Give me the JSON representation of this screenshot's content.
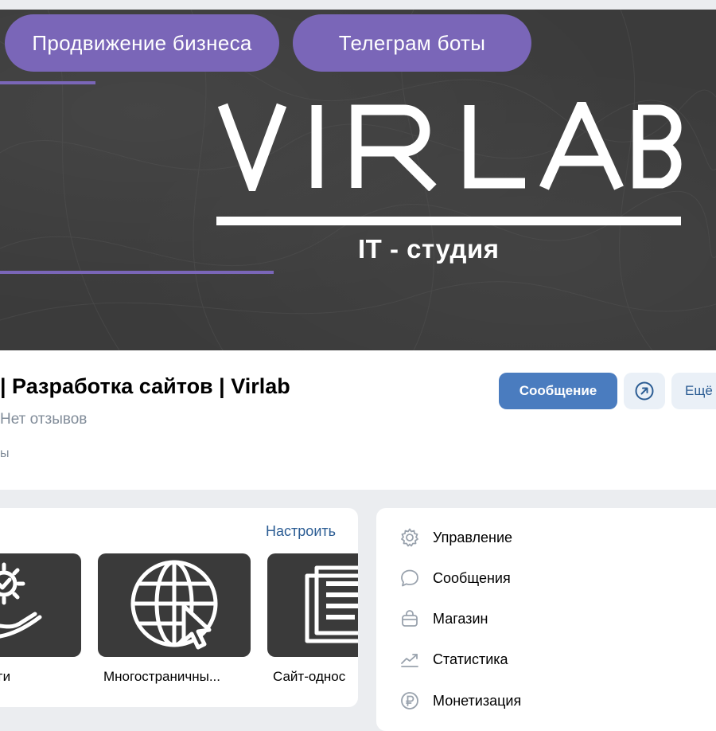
{
  "cover": {
    "buttons": [
      "Продвижение бизнеса",
      "Телеграм боты"
    ],
    "logo_text": "VIRLAB",
    "subtitle": "IT - студия",
    "accent_color": "#7a66b8"
  },
  "profile": {
    "name": "| Разработка сайтов | Virlab",
    "reviews": "Нет отзывов",
    "category": "ы",
    "message_button": "Сообщение",
    "share_icon": "arrow-up-right-circle-icon",
    "more_button": "Ещё"
  },
  "services": {
    "configure_link": "Настроить",
    "items": [
      {
        "label": "луги",
        "icon": "gear-hand-icon"
      },
      {
        "label": "Многостраничны...",
        "icon": "globe-cursor-icon"
      },
      {
        "label": "Сайт-однос",
        "icon": "document-pages-icon"
      }
    ]
  },
  "admin_menu": {
    "items": [
      {
        "label": "Управление",
        "icon": "gear-icon"
      },
      {
        "label": "Сообщения",
        "icon": "chat-bubble-icon"
      },
      {
        "label": "Магазин",
        "icon": "shopping-bag-icon"
      },
      {
        "label": "Статистика",
        "icon": "trend-chart-icon"
      },
      {
        "label": "Монетизация",
        "icon": "ruble-coin-icon"
      }
    ]
  },
  "colors": {
    "primary_button": "#4a7cbf",
    "link": "#2c5d94",
    "secondary_text": "#818c99",
    "page_bg": "#ebedf0"
  }
}
